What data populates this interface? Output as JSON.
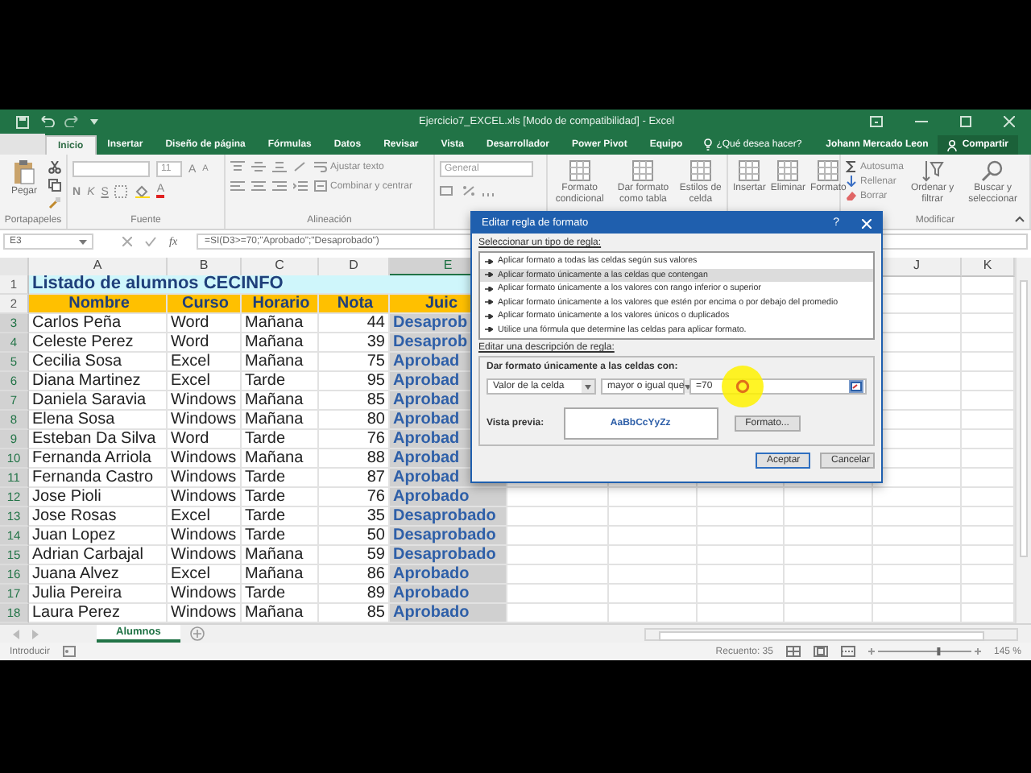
{
  "title_bar": {
    "title": "Ejercicio7_EXCEL.xls  [Modo de compatibilidad] - Excel"
  },
  "ribbon_tabs": [
    {
      "label": "Inicio",
      "selected": true
    },
    {
      "label": "Insertar",
      "selected": false
    },
    {
      "label": "Diseño de página",
      "selected": false
    },
    {
      "label": "Fórmulas",
      "selected": false
    },
    {
      "label": "Datos",
      "selected": false
    },
    {
      "label": "Revisar",
      "selected": false
    },
    {
      "label": "Vista",
      "selected": false
    },
    {
      "label": "Desarrollador",
      "selected": false
    },
    {
      "label": "Power Pivot",
      "selected": false
    },
    {
      "label": "Equipo",
      "selected": false
    }
  ],
  "tell_me": "¿Qué desea hacer?",
  "user": "Johann Mercado Leon",
  "share_button": "Compartir",
  "ribbon_groups": [
    {
      "kind": "clipboard",
      "label": "Portapapeles",
      "paste": "Pegar"
    },
    {
      "kind": "font",
      "label": "Fuente",
      "font_size": "11",
      "grow": "A",
      "shrink": "A",
      "bold": "N",
      "italic": "K",
      "underline": "S",
      "font_color": "A"
    },
    {
      "kind": "alignment",
      "label": "Alineación",
      "wrap": "Ajustar texto",
      "merge": "Combinar y centrar"
    },
    {
      "kind": "number",
      "format": "General"
    },
    {
      "kind": "large_buttons",
      "buttons": [
        "Formato condicional",
        "Dar formato como tabla",
        "Estilos de celda"
      ]
    },
    {
      "kind": "large_buttons",
      "buttons": [
        "Insertar",
        "Eliminar",
        "Formato"
      ]
    },
    {
      "kind": "editing",
      "label": "Modificar",
      "small": [
        "Autosuma",
        "Rellenar",
        "Borrar"
      ],
      "large": [
        "Ordenar y filtrar",
        "Buscar y seleccionar"
      ]
    }
  ],
  "formula_bar": {
    "name_box": "E3",
    "fx": "fx",
    "formula": "=SI(D3>=70;\"Aprobado\";\"Desaprobado\")"
  },
  "columns": [
    {
      "label": "A",
      "selected": false
    },
    {
      "label": "B",
      "selected": false
    },
    {
      "label": "C",
      "selected": false
    },
    {
      "label": "D",
      "selected": false
    },
    {
      "label": "E",
      "selected": true
    },
    {
      "label": "J",
      "selected": false
    },
    {
      "label": "K",
      "selected": false
    }
  ],
  "rows": [
    {
      "number": "1",
      "kind": "title",
      "text": "Listado de alumnos CECINFO"
    },
    {
      "number": "2",
      "kind": "header",
      "cells": [
        "Nombre",
        "Curso",
        "Horario",
        "Nota",
        "Juic"
      ]
    },
    {
      "number": "3",
      "kind": "data",
      "cells": [
        "Carlos Peña",
        "Word",
        "Mañana",
        "44"
      ],
      "result": "Desaprob",
      "selected": true
    },
    {
      "number": "4",
      "kind": "data",
      "cells": [
        "Celeste Perez",
        "Word",
        "Mañana",
        "39"
      ],
      "result": "Desaprob",
      "selected": true
    },
    {
      "number": "5",
      "kind": "data",
      "cells": [
        "Cecilia Sosa",
        "Excel",
        "Mañana",
        "75"
      ],
      "result": "Aprobad",
      "selected": true
    },
    {
      "number": "6",
      "kind": "data",
      "cells": [
        "Diana Martinez",
        "Excel",
        "Tarde",
        "95"
      ],
      "result": "Aprobad",
      "selected": true
    },
    {
      "number": "7",
      "kind": "data",
      "cells": [
        "Daniela Saravia",
        "Windows",
        "Mañana",
        "85"
      ],
      "result": "Aprobad",
      "selected": true
    },
    {
      "number": "8",
      "kind": "data",
      "cells": [
        "Elena Sosa",
        "Windows",
        "Mañana",
        "80"
      ],
      "result": "Aprobad",
      "selected": true
    },
    {
      "number": "9",
      "kind": "data",
      "cells": [
        "Esteban Da Silva",
        "Word",
        "Tarde",
        "76"
      ],
      "result": "Aprobad",
      "selected": true
    },
    {
      "number": "10",
      "kind": "data",
      "cells": [
        "Fernanda Arriola",
        "Windows",
        "Mañana",
        "88"
      ],
      "result": "Aprobad",
      "selected": true
    },
    {
      "number": "11",
      "kind": "data",
      "cells": [
        "Fernanda Castro",
        "Windows",
        "Tarde",
        "87"
      ],
      "result": "Aprobad",
      "selected": true
    },
    {
      "number": "12",
      "kind": "data",
      "cells": [
        "Jose Pioli",
        "Windows",
        "Tarde",
        "76"
      ],
      "result": "Aprobado",
      "selected": true
    },
    {
      "number": "13",
      "kind": "data",
      "cells": [
        "Jose Rosas",
        "Excel",
        "Tarde",
        "35"
      ],
      "result": "Desaprobado",
      "selected": true
    },
    {
      "number": "14",
      "kind": "data",
      "cells": [
        "Juan Lopez",
        "Windows",
        "Tarde",
        "50"
      ],
      "result": "Desaprobado",
      "selected": true
    },
    {
      "number": "15",
      "kind": "data",
      "cells": [
        "Adrian Carbajal",
        "Windows",
        "Mañana",
        "59"
      ],
      "result": "Desaprobado",
      "selected": true
    },
    {
      "number": "16",
      "kind": "data",
      "cells": [
        "Juana Alvez",
        "Excel",
        "Mañana",
        "86"
      ],
      "result": "Aprobado",
      "selected": true
    },
    {
      "number": "17",
      "kind": "data",
      "cells": [
        "Julia Pereira",
        "Windows",
        "Tarde",
        "89"
      ],
      "result": "Aprobado",
      "selected": true
    },
    {
      "number": "18",
      "kind": "data",
      "cells": [
        "Laura Perez",
        "Windows",
        "Mañana",
        "85"
      ],
      "result": "Aprobado",
      "selected": true
    }
  ],
  "sheet_tabs": [
    {
      "label": "Alumnos",
      "selected": true
    }
  ],
  "status_bar": {
    "mode": "Introducir",
    "count": "Recuento: 35",
    "level": 0.65,
    "zoom": "145 %"
  },
  "dialog": {
    "title": "Editar regla de formato",
    "help": "?",
    "rule_type_label": "Seleccionar un tipo de regla:",
    "rule_types": [
      {
        "label": "Aplicar formato a todas las celdas según sus valores",
        "selected": false
      },
      {
        "label": "Aplicar formato únicamente a las celdas que contengan",
        "selected": true
      },
      {
        "label": "Aplicar formato únicamente a los valores con rango inferior o superior",
        "selected": false
      },
      {
        "label": "Aplicar formato únicamente a los valores que estén por encima o por debajo del promedio",
        "selected": false
      },
      {
        "label": "Aplicar formato únicamente a los valores únicos o duplicados",
        "selected": false
      },
      {
        "label": "Utilice una fórmula que determine las celdas para aplicar formato.",
        "selected": false
      }
    ],
    "description_label": "Editar una descripción de regla:",
    "condition_label": "Dar formato únicamente a las celdas con:",
    "condition_source": "Valor de la celda",
    "operator": "mayor o igual que",
    "value": "=70",
    "preview_label": "Vista previa:",
    "preview_text": "AaBbCcYyZz",
    "format_button": "Formato...",
    "ok_button": "Aceptar",
    "cancel_button": "Cancelar"
  }
}
